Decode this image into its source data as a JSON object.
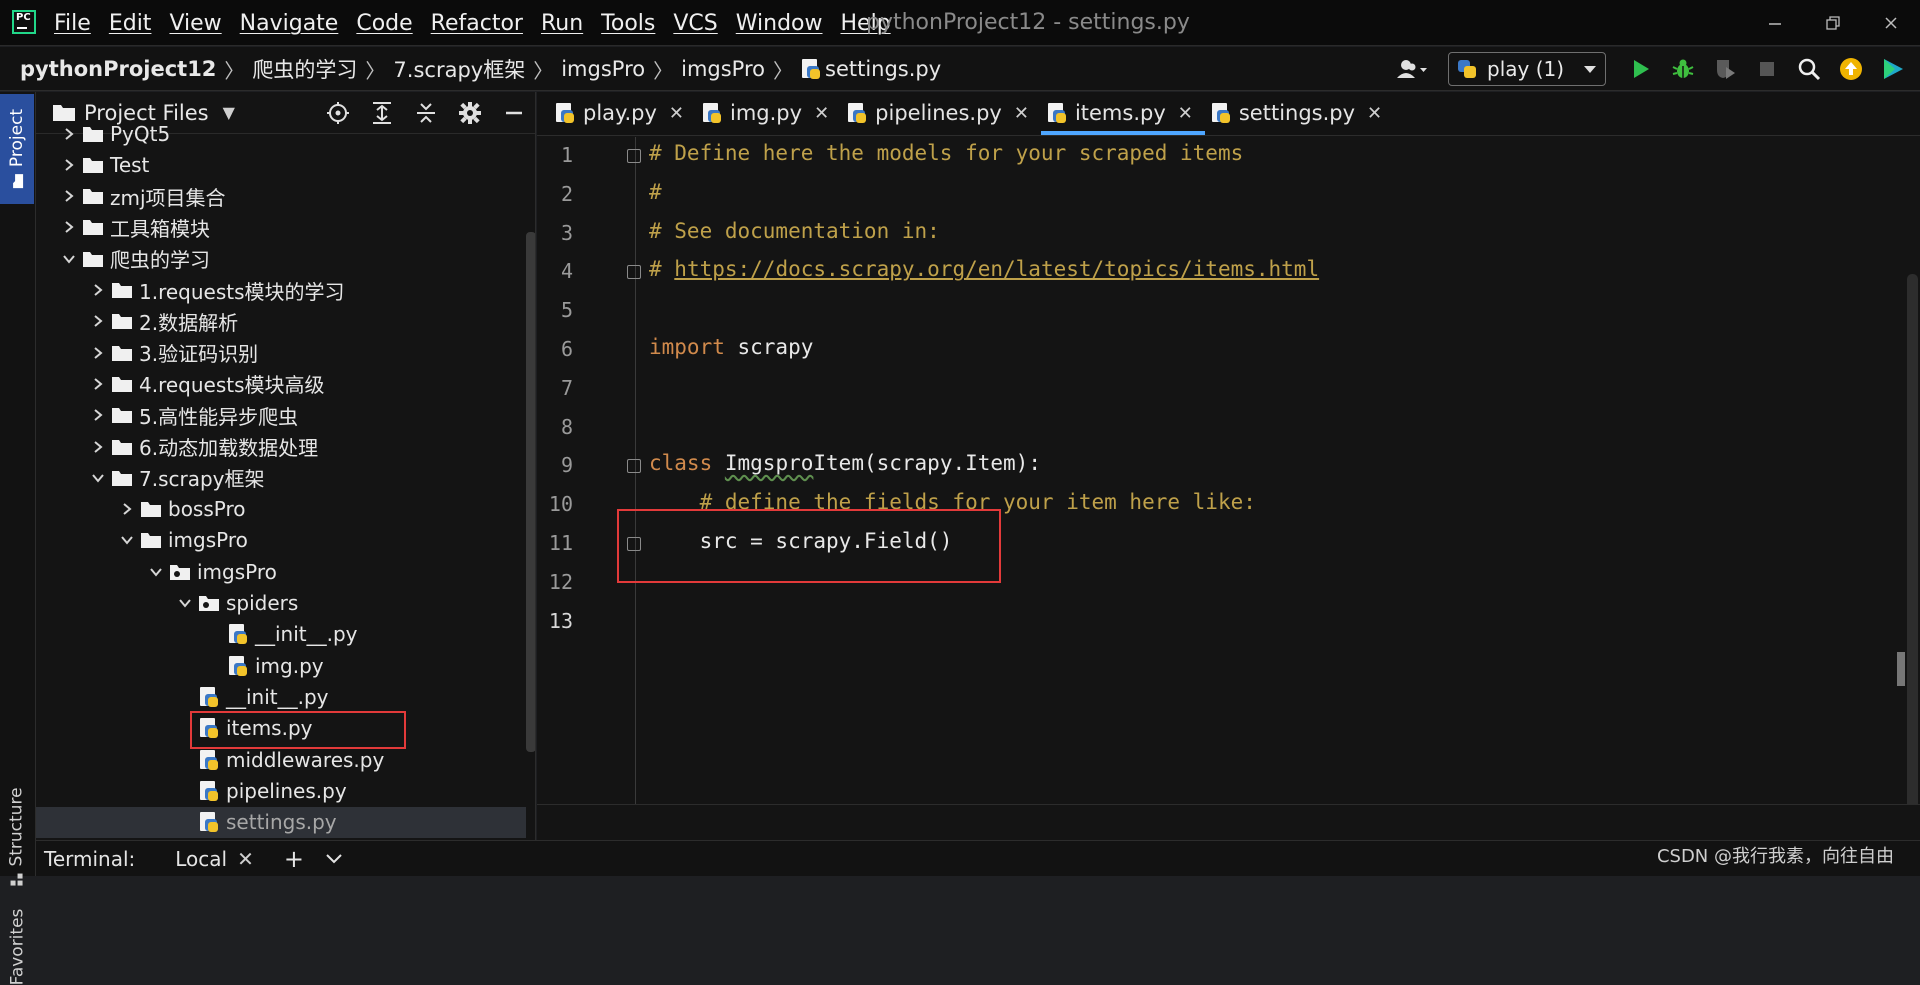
{
  "app": {
    "logo_text": "PC",
    "window_title": "pythonProject12 - settings.py",
    "menu": [
      "File",
      "Edit",
      "View",
      "Navigate",
      "Code",
      "Refactor",
      "Run",
      "Tools",
      "VCS",
      "Window",
      "Help"
    ]
  },
  "breadcrumb": [
    "pythonProject12",
    "爬虫的学习",
    "7.scrapy框架",
    "imgsPro",
    "imgsPro",
    "settings.py"
  ],
  "run_config": {
    "name": "play (1)"
  },
  "tool_windows": {
    "project": "Project",
    "structure": "Structure",
    "favorites": "Favorites"
  },
  "project_panel": {
    "title": "Project Files",
    "tree": [
      {
        "label": "PyQt5",
        "depth": 0,
        "type": "folder",
        "expanded": false
      },
      {
        "label": "Test",
        "depth": 0,
        "type": "folder",
        "expanded": false
      },
      {
        "label": "zmj项目集合",
        "depth": 0,
        "type": "folder",
        "expanded": false
      },
      {
        "label": "工具箱模块",
        "depth": 0,
        "type": "folder",
        "expanded": false
      },
      {
        "label": "爬虫的学习",
        "depth": 0,
        "type": "folder",
        "expanded": true
      },
      {
        "label": "1.requests模块的学习",
        "depth": 1,
        "type": "folder",
        "expanded": false
      },
      {
        "label": "2.数据解析",
        "depth": 1,
        "type": "folder",
        "expanded": false
      },
      {
        "label": "3.验证码识别",
        "depth": 1,
        "type": "folder",
        "expanded": false
      },
      {
        "label": "4.requests模块高级",
        "depth": 1,
        "type": "folder",
        "expanded": false
      },
      {
        "label": "5.高性能异步爬虫",
        "depth": 1,
        "type": "folder",
        "expanded": false
      },
      {
        "label": "6.动态加载数据处理",
        "depth": 1,
        "type": "folder",
        "expanded": false
      },
      {
        "label": "7.scrapy框架",
        "depth": 1,
        "type": "folder",
        "expanded": true
      },
      {
        "label": "bossPro",
        "depth": 2,
        "type": "folder",
        "expanded": false
      },
      {
        "label": "imgsPro",
        "depth": 2,
        "type": "folder",
        "expanded": true
      },
      {
        "label": "imgsPro",
        "depth": 3,
        "type": "package",
        "expanded": true
      },
      {
        "label": "spiders",
        "depth": 4,
        "type": "package",
        "expanded": true
      },
      {
        "label": "__init__.py",
        "depth": 5,
        "type": "py"
      },
      {
        "label": "img.py",
        "depth": 5,
        "type": "py"
      },
      {
        "label": "__init__.py",
        "depth": 4,
        "type": "py"
      },
      {
        "label": "items.py",
        "depth": 4,
        "type": "py",
        "highlighted": true
      },
      {
        "label": "middlewares.py",
        "depth": 4,
        "type": "py"
      },
      {
        "label": "pipelines.py",
        "depth": 4,
        "type": "py"
      },
      {
        "label": "settings.py",
        "depth": 4,
        "type": "py",
        "selected": true
      }
    ]
  },
  "editor": {
    "tabs": [
      {
        "label": "play.py",
        "active": false
      },
      {
        "label": "img.py",
        "active": false
      },
      {
        "label": "pipelines.py",
        "active": false
      },
      {
        "label": "items.py",
        "active": true
      },
      {
        "label": "settings.py",
        "active": false
      }
    ],
    "inspections": {
      "warnings": "1",
      "ok": "1"
    },
    "current_line": 13,
    "lines": [
      "# Define here the models for your scraped items",
      "#",
      "# See documentation in:",
      "# https://docs.scrapy.org/en/latest/topics/items.html",
      "",
      "import scrapy",
      "",
      "",
      "class ImgsproItem(scrapy.Item):",
      "    # define the fields for your item here like:",
      "    src = scrapy.Field()",
      "",
      ""
    ]
  },
  "terminal": {
    "label": "Terminal:",
    "session": "Local"
  },
  "watermark": "CSDN @我行我素，向往自由"
}
